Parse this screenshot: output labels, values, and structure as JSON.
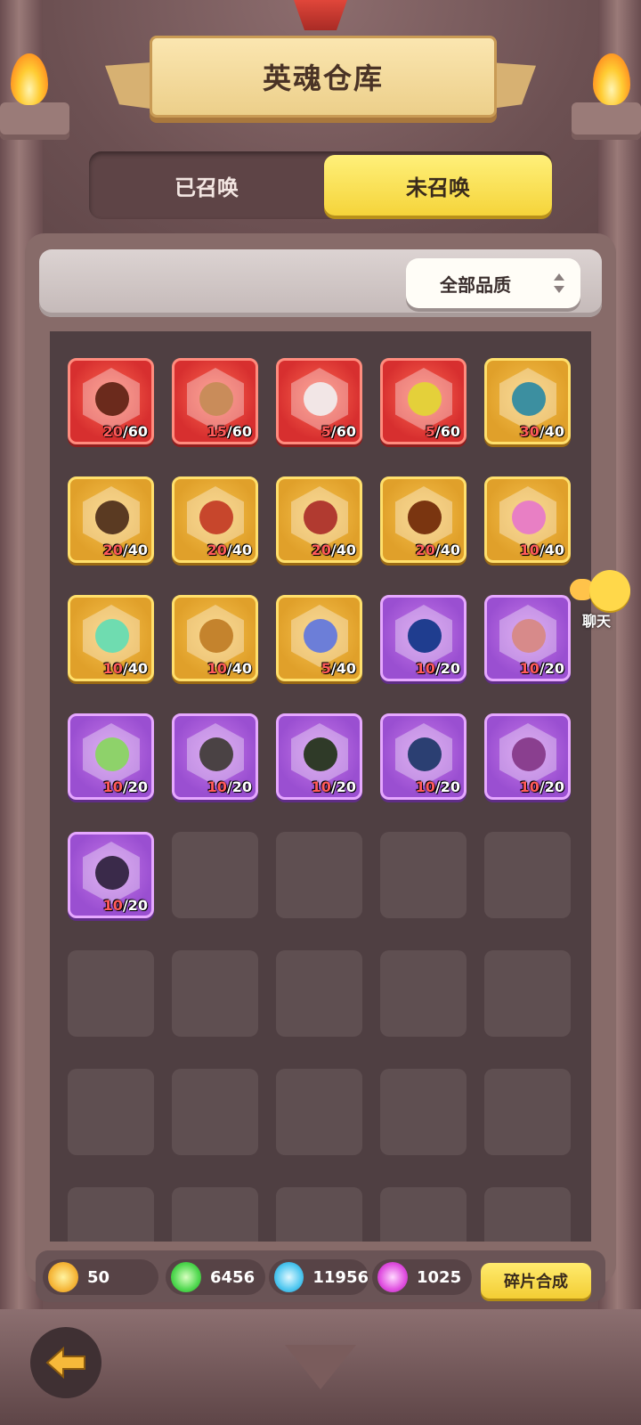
{
  "header": {
    "title": "英魂仓库"
  },
  "tabs": [
    {
      "label": "已召唤",
      "active": false
    },
    {
      "label": "未召唤",
      "active": true
    }
  ],
  "filter": {
    "selected": "全部品质"
  },
  "colors": {
    "red_quality": "#d72f2f",
    "gold_quality": "#e0a02a",
    "purple_quality": "#9a4fd1",
    "active_tab": "#f5d43a"
  },
  "shards": [
    {
      "rarity": "red",
      "current": "20",
      "max": "/60",
      "face": "#6b2a1c"
    },
    {
      "rarity": "red",
      "current": "15",
      "max": "/60",
      "face": "#c98c5a"
    },
    {
      "rarity": "red",
      "current": "5",
      "max": "/60",
      "face": "#f2e6e6"
    },
    {
      "rarity": "red",
      "current": "5",
      "max": "/60",
      "face": "#e4d03a"
    },
    {
      "rarity": "gold",
      "current": "30",
      "max": "/40",
      "face": "#3c8fa0"
    },
    {
      "rarity": "gold",
      "current": "20",
      "max": "/40",
      "face": "#5a3a22"
    },
    {
      "rarity": "gold",
      "current": "20",
      "max": "/40",
      "face": "#c7462c"
    },
    {
      "rarity": "gold",
      "current": "20",
      "max": "/40",
      "face": "#b13a30"
    },
    {
      "rarity": "gold",
      "current": "20",
      "max": "/40",
      "face": "#7a3510"
    },
    {
      "rarity": "gold",
      "current": "10",
      "max": "/40",
      "face": "#e87fc4"
    },
    {
      "rarity": "gold",
      "current": "10",
      "max": "/40",
      "face": "#6fdcb0"
    },
    {
      "rarity": "gold",
      "current": "10",
      "max": "/40",
      "face": "#c4832d"
    },
    {
      "rarity": "gold",
      "current": "5",
      "max": "/40",
      "face": "#6c7ed8"
    },
    {
      "rarity": "purple",
      "current": "10",
      "max": "/20",
      "face": "#1f3d8f"
    },
    {
      "rarity": "purple",
      "current": "10",
      "max": "/20",
      "face": "#d78a8a"
    },
    {
      "rarity": "purple",
      "current": "10",
      "max": "/20",
      "face": "#8ed26a"
    },
    {
      "rarity": "purple",
      "current": "10",
      "max": "/20",
      "face": "#4a4244"
    },
    {
      "rarity": "purple",
      "current": "10",
      "max": "/20",
      "face": "#2f3a28"
    },
    {
      "rarity": "purple",
      "current": "10",
      "max": "/20",
      "face": "#2b3f72"
    },
    {
      "rarity": "purple",
      "current": "10",
      "max": "/20",
      "face": "#8a3f8f"
    },
    {
      "rarity": "purple",
      "current": "10",
      "max": "/20",
      "face": "#3a2a4a"
    }
  ],
  "empty_slots": 19,
  "chat": {
    "label": "聊天"
  },
  "resources": [
    {
      "icon": "gold-flame-icon",
      "value": "50",
      "color": "#f5b73a"
    },
    {
      "icon": "green-flame-icon",
      "value": "6456",
      "color": "#4fd84f"
    },
    {
      "icon": "blue-flame-icon",
      "value": "11956",
      "color": "#4ec7f0"
    },
    {
      "icon": "purple-flame-icon",
      "value": "1025",
      "color": "#e04fe0"
    }
  ],
  "compose_button": "碎片合成"
}
